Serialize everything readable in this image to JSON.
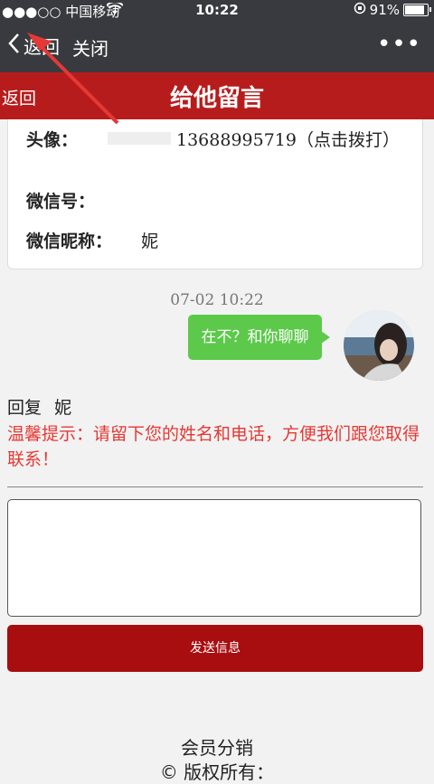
{
  "status": {
    "carrier": "●●●○○ 中国移动",
    "wifi_icon": "wifi-icon",
    "time": "10:22",
    "rotation_lock_icon": "rotation-lock-icon",
    "battery": "91%"
  },
  "nav": {
    "back_label": "返回",
    "close_label": "关闭",
    "more_label": "•••"
  },
  "page_header": {
    "back_label": "返回",
    "title": "给他留言"
  },
  "card": {
    "avatar_label": "头像：",
    "phone": "13688995719（点击拨打）",
    "wechat_label": "微信号：",
    "nickname_label": "微信昵称：",
    "nickname_value": "妮"
  },
  "chat": {
    "timestamp": "07-02 10:22",
    "message": "在不？和你聊聊"
  },
  "reply": {
    "prefix": "回复",
    "name": "妮"
  },
  "tip": "温馨提示：请留下您的姓名和电话，方便我们跟您取得联系！",
  "message_input": {
    "value": ""
  },
  "send_button": "发送信息",
  "footer": {
    "line1": "会员分销",
    "line2": "© 版权所有："
  },
  "colors": {
    "nav_bg": "#393a3f",
    "header_red": "#b71c1c",
    "bubble_green": "#5cc94b",
    "tip_red": "#e53935",
    "button_red": "#a80d10"
  }
}
